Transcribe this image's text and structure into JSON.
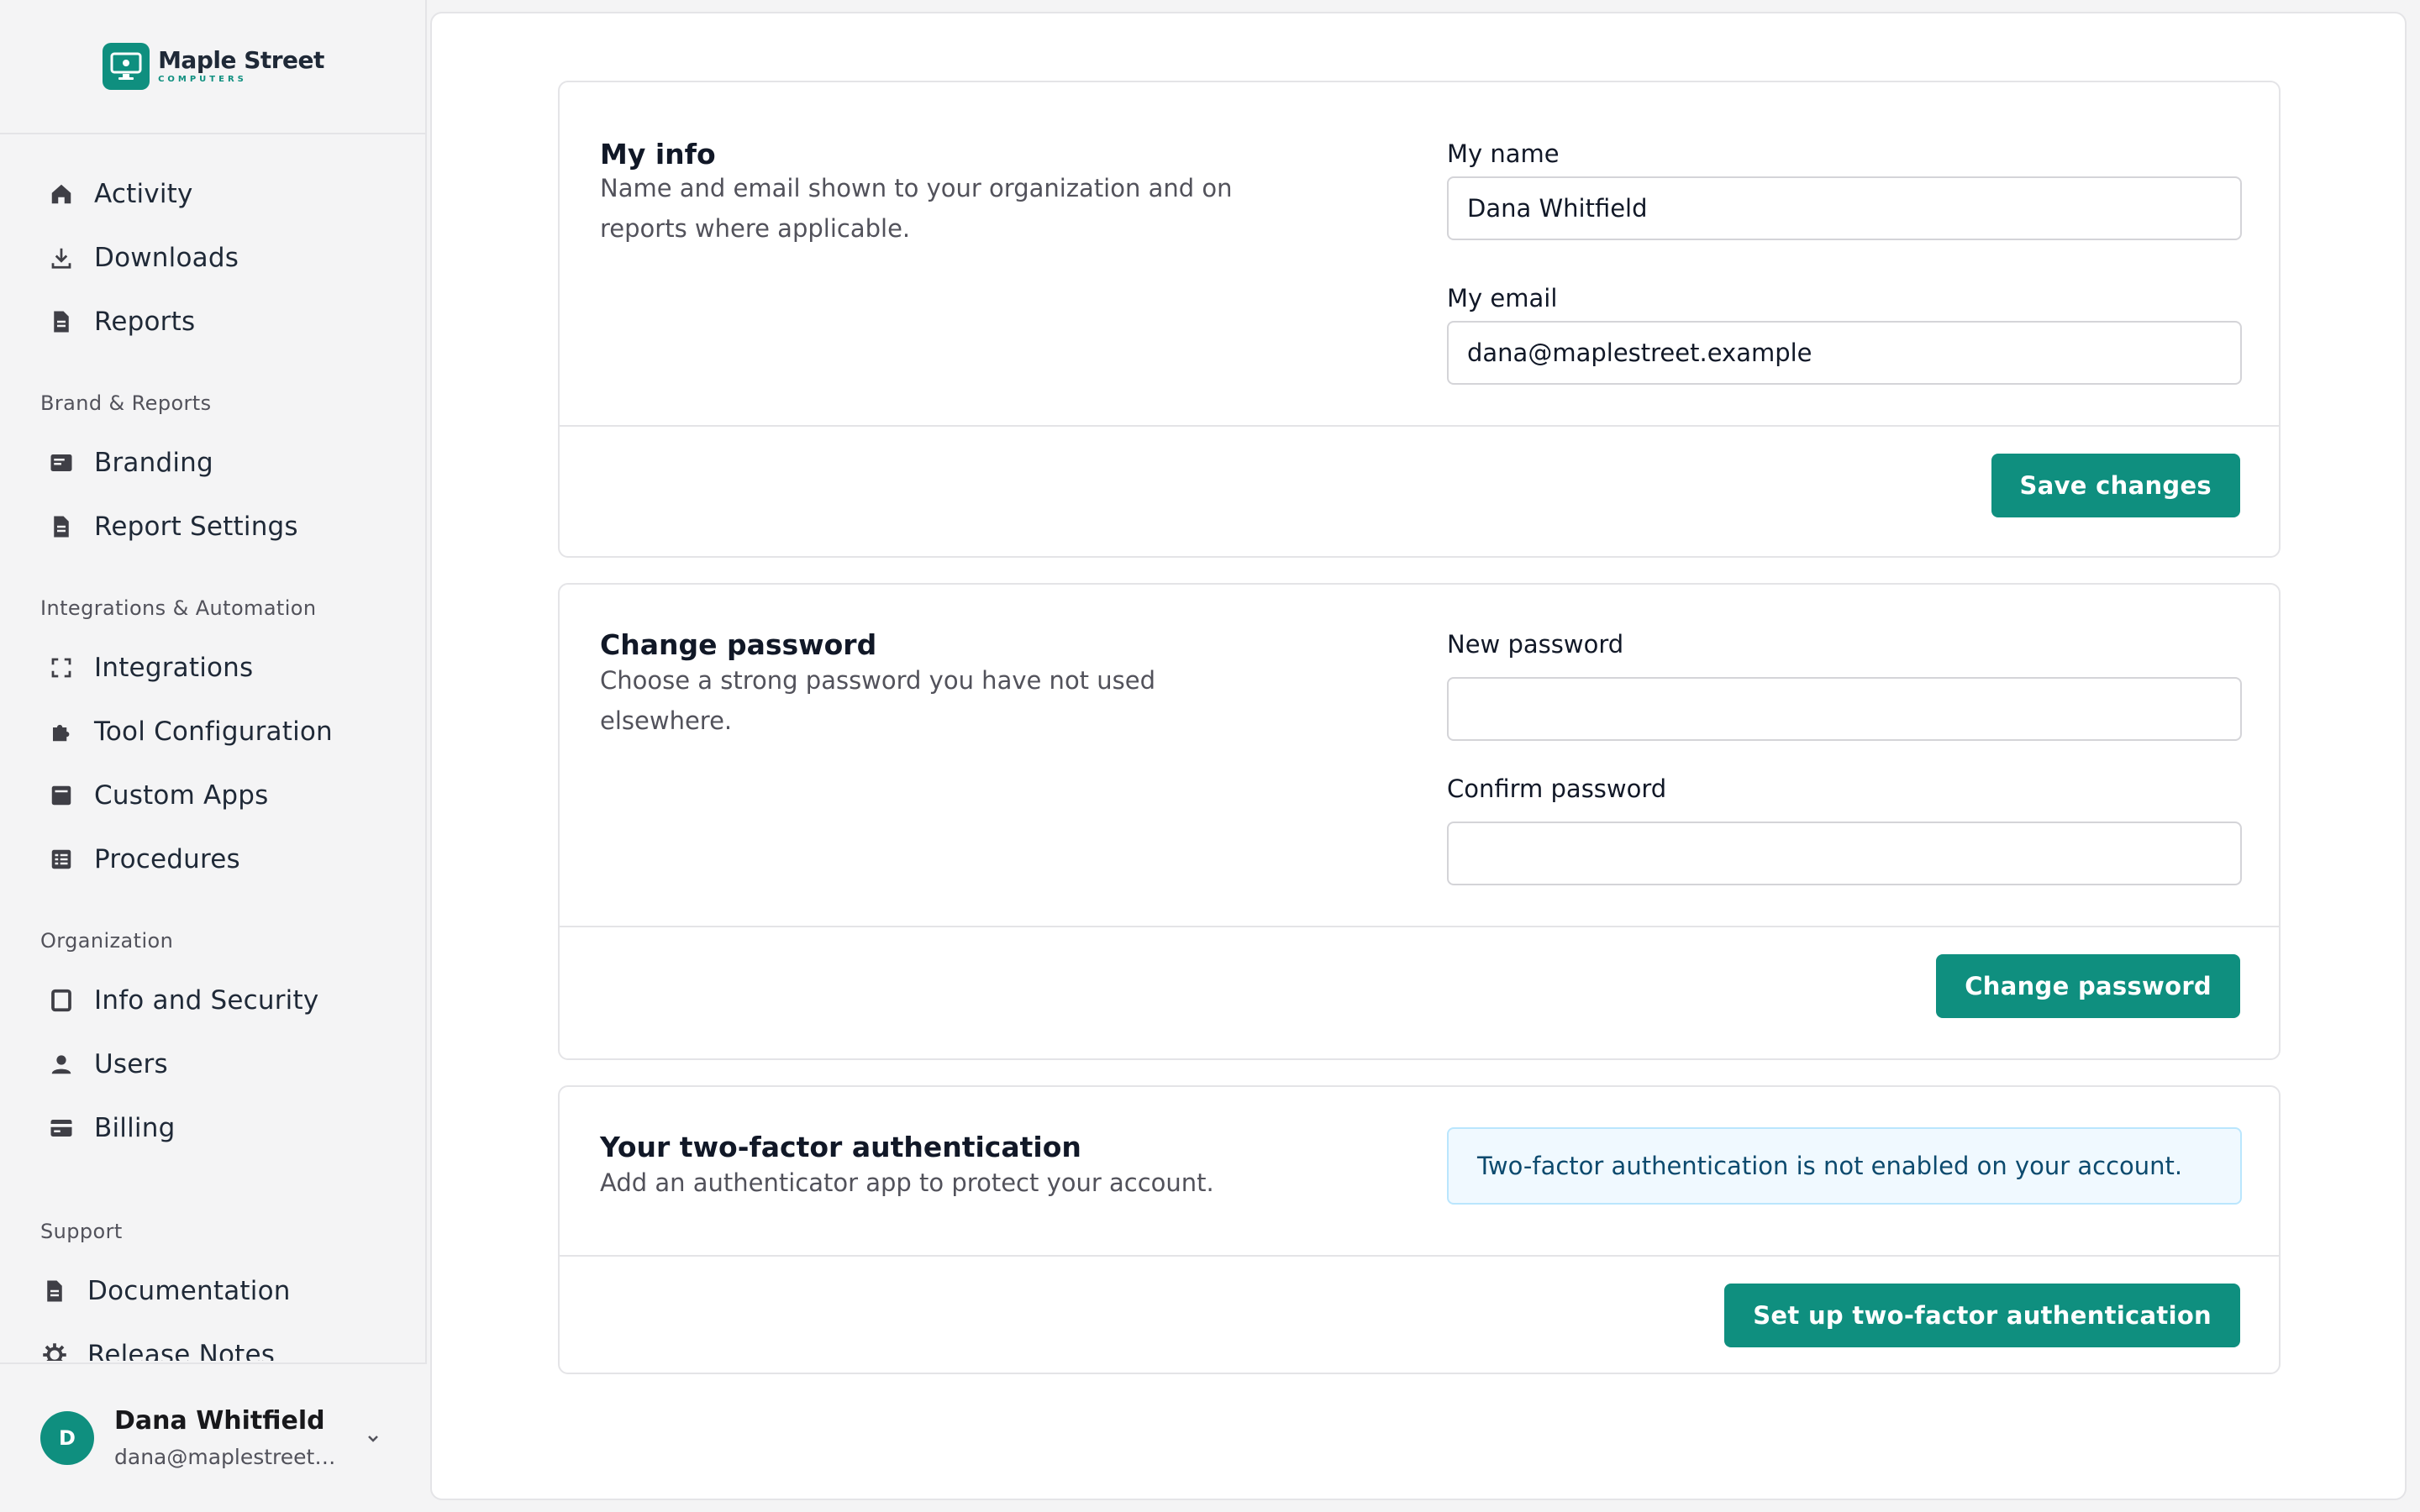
{
  "brand": {
    "name": "Maple Street",
    "sub": "COMPUTERS"
  },
  "nav": {
    "main": [
      {
        "label": "Activity",
        "icon": "home-icon"
      },
      {
        "label": "Downloads",
        "icon": "download-icon"
      },
      {
        "label": "Reports",
        "icon": "document-icon"
      }
    ],
    "sections": [
      {
        "title": "Brand & Reports",
        "items": [
          {
            "label": "Branding",
            "icon": "card-icon"
          },
          {
            "label": "Report Settings",
            "icon": "document-icon"
          }
        ]
      },
      {
        "title": "Integrations & Automation",
        "items": [
          {
            "label": "Integrations",
            "icon": "integrations-icon"
          },
          {
            "label": "Tool Configuration",
            "icon": "puzzle-icon"
          },
          {
            "label": "Custom Apps",
            "icon": "app-icon"
          },
          {
            "label": "Procedures",
            "icon": "list-icon"
          }
        ]
      },
      {
        "title": "Organization",
        "items": [
          {
            "label": "Info and Security",
            "icon": "square-icon"
          },
          {
            "label": "Users",
            "icon": "user-icon"
          },
          {
            "label": "Billing",
            "icon": "credit-card-icon"
          }
        ]
      },
      {
        "title": "Support",
        "items": [
          {
            "label": "Documentation",
            "icon": "document-icon"
          },
          {
            "label": "Release Notes",
            "icon": "gear-icon"
          }
        ]
      }
    ]
  },
  "user": {
    "initial": "D",
    "name": "Dana Whitfield",
    "email": "dana@maplestreet.example"
  },
  "my_info": {
    "title": "My info",
    "description": "Name and email shown to your organization and on reports where applicable.",
    "name_label": "My name",
    "name_value": "Dana Whitfield",
    "email_label": "My email",
    "email_value": "dana@maplestreet.example",
    "save_label": "Save changes"
  },
  "password": {
    "title": "Change password",
    "description": "Choose a strong password you have not used elsewhere.",
    "new_label": "New password",
    "new_value": "",
    "confirm_label": "Confirm password",
    "confirm_value": "",
    "button_label": "Change password"
  },
  "two_factor": {
    "title": "Your two-factor authentication",
    "description": "Add an authenticator app to protect your account.",
    "notice": "Two-factor authentication is not enabled on your account.",
    "button_label": "Set up two-factor authentication"
  },
  "colors": {
    "accent": "#0f8f7f",
    "notice_bg": "#f0f9ff",
    "notice_border": "#bae6fd"
  }
}
